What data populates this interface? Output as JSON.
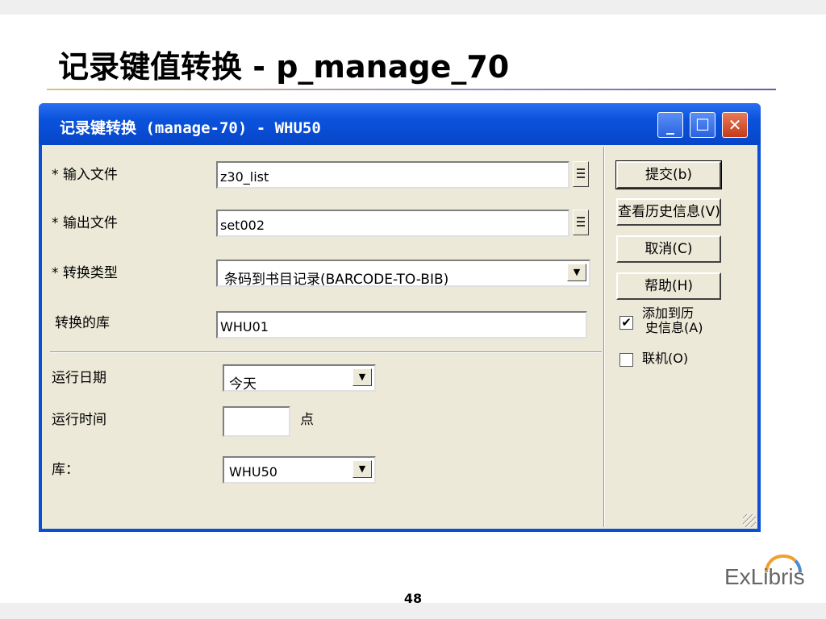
{
  "slide": {
    "title": "记录键值转换 - p_manage_70",
    "page_number": "48",
    "logo": "ExLibris"
  },
  "window": {
    "title": "记录键转换 (manage-70) - WHU50",
    "controls": {
      "minimize_icon": "minimize-icon",
      "maximize_icon": "maximize-icon",
      "close_icon": "close-icon"
    }
  },
  "form": {
    "input_file": {
      "label": "* 输入文件",
      "value": "z30_list"
    },
    "output_file": {
      "label": "* 输出文件",
      "value": "set002"
    },
    "conversion_type": {
      "label": "* 转换类型",
      "value": "条码到书目记录(BARCODE-TO-BIB)"
    },
    "target_library": {
      "label": "转换的库",
      "value": "WHU01"
    },
    "run_date": {
      "label": "运行日期",
      "value": "今天"
    },
    "run_time": {
      "label": "运行时间",
      "value": "",
      "suffix": "点"
    },
    "library": {
      "label": "库：",
      "value": "WHU50"
    }
  },
  "buttons": {
    "submit": "提交(b)",
    "history": "查看历史信息(V)",
    "cancel": "取消(C)",
    "help": "帮助(H)"
  },
  "checkboxes": {
    "add_history": {
      "label_line1": "添加到历",
      "label_line2": "史信息(A)",
      "checked": true,
      "mark": "✔"
    },
    "online": {
      "label": "联机(O)",
      "checked": false,
      "mark": ""
    }
  },
  "colors": {
    "titlebar": "#0a52dc",
    "client": "#ece9d8"
  }
}
